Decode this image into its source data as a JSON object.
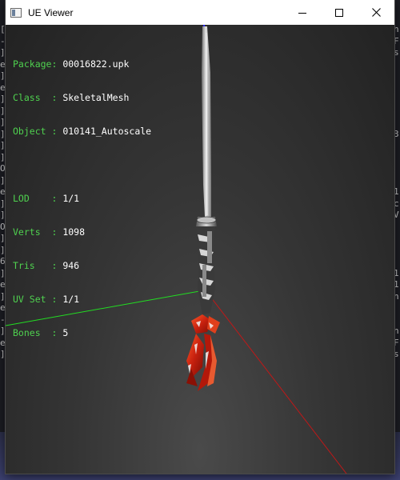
{
  "window": {
    "title": "UE Viewer",
    "controls": {
      "minimize_glyph": "—",
      "maximize_glyph": "☐",
      "close_glyph": "✕"
    }
  },
  "info": {
    "package": {
      "label": "Package",
      "sep": ": ",
      "value": "00016822.upk"
    },
    "class": {
      "label": "Class  ",
      "sep": ": ",
      "value": "SkeletalMesh"
    },
    "object": {
      "label": "Object ",
      "sep": ": ",
      "value": "010141_Autoscale"
    },
    "lod": {
      "label": "LOD    ",
      "sep": ": ",
      "value": "1/1"
    },
    "verts": {
      "label": "Verts  ",
      "sep": ": ",
      "value": "1098"
    },
    "tris": {
      "label": "Tris   ",
      "sep": ": ",
      "value": "946"
    },
    "uvset": {
      "label": "UV Set ",
      "sep": ": ",
      "value": "1/1"
    },
    "bones": {
      "label": "Bones  ",
      "sep": ": ",
      "value": "5"
    }
  },
  "background_left_glyphs": "[\n-\n]\ne\n]\ne\n]\n]\n]\n]\n]\n]\nO\n]\ne\n]\n]\nO\n]\n]\n6\n]\ne\n]\ne\n-\n]\ne\n]",
  "background_right_glyphs": "n\nF\ns\n\n\n\n\n\n\n3\n\n\n\n\n1\nc\nV\n\n\n\n\n1\n1\nn\n\n\nn\nF\ns",
  "colors": {
    "label_green": "#4fd14f",
    "value_white": "#ffffff",
    "axis_green": "#22dd22",
    "axis_red": "#c01818",
    "axis_blue": "#2a2aff"
  }
}
